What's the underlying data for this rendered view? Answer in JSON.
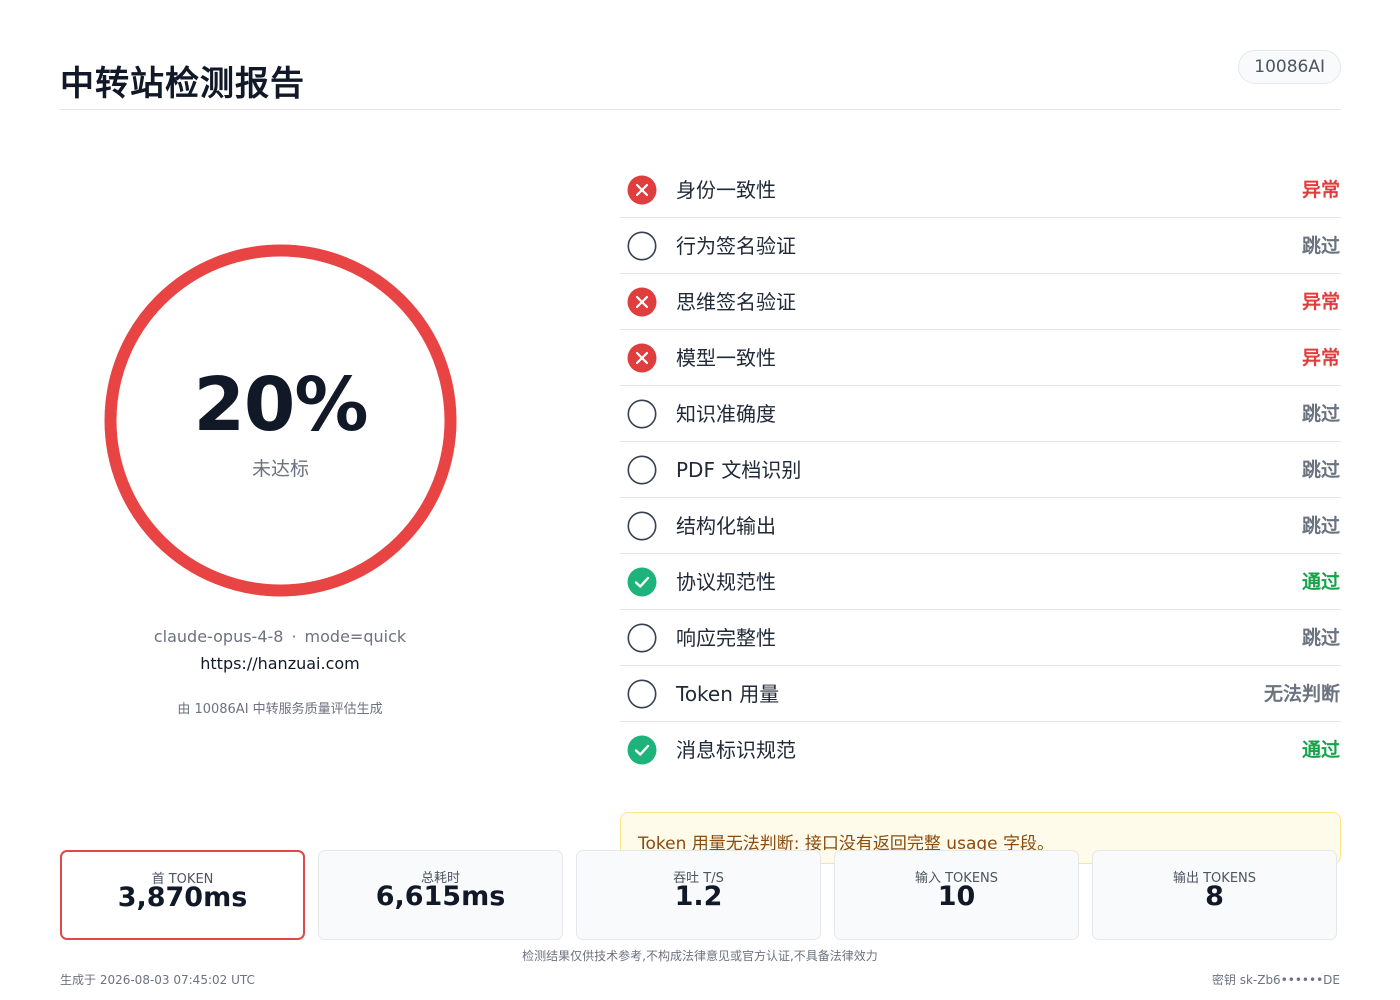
{
  "header": {
    "title": "中转站检测报告",
    "badge": "10086AI"
  },
  "score": {
    "percent": 20,
    "value_text": "20%",
    "label": "未达标",
    "ring_color": "#e84444"
  },
  "meta": {
    "model": "claude-opus-4-8",
    "separator": "·",
    "mode": "mode=quick",
    "url": "https://hanzuai.com",
    "generated_by": "由 10086AI 中转服务质量评估生成"
  },
  "checks": [
    {
      "name": "身份一致性",
      "status": "异常",
      "state": "fail"
    },
    {
      "name": "行为签名验证",
      "status": "跳过",
      "state": "skip"
    },
    {
      "name": "思维签名验证",
      "status": "异常",
      "state": "fail"
    },
    {
      "name": "模型一致性",
      "status": "异常",
      "state": "fail"
    },
    {
      "name": "知识准确度",
      "status": "跳过",
      "state": "skip"
    },
    {
      "name": "PDF 文档识别",
      "status": "跳过",
      "state": "skip"
    },
    {
      "name": "结构化输出",
      "status": "跳过",
      "state": "skip"
    },
    {
      "name": "协议规范性",
      "status": "通过",
      "state": "pass"
    },
    {
      "name": "响应完整性",
      "status": "跳过",
      "state": "skip"
    },
    {
      "name": "Token 用量",
      "status": "无法判断",
      "state": "unknown"
    },
    {
      "name": "消息标识规范",
      "status": "通过",
      "state": "pass"
    }
  ],
  "colors": {
    "fail": "#e03e3e",
    "pass": "#16a34a",
    "pass_icon": "#1db37a",
    "skip": "#6b7280",
    "unknown": "#6b7280"
  },
  "notice": "Token 用量无法判断: 接口没有返回完整 usage 字段。",
  "metrics": [
    {
      "label": "首 TOKEN",
      "value": "3,870ms"
    },
    {
      "label": "总耗时",
      "value": "6,615ms"
    },
    {
      "label": "吞吐 T/S",
      "value": "1.2"
    },
    {
      "label": "输入 TOKENS",
      "value": "10"
    },
    {
      "label": "输出 TOKENS",
      "value": "8"
    }
  ],
  "footer": {
    "disclaimer": "检测结果仅供技术参考,不构成法律意见或官方认证,不具备法律效力",
    "generated_at": "生成于 2026-08-03 07:45:02 UTC",
    "key": "密钥 sk-Zb6••••••DE"
  }
}
